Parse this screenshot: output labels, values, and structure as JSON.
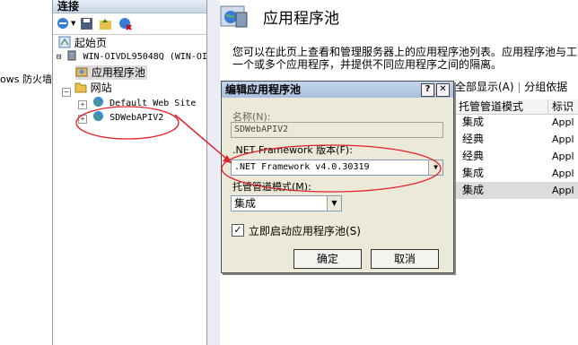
{
  "left_strip": {
    "text": "ows 防火墙"
  },
  "connections": {
    "title": "连接",
    "tree": [
      {
        "label": "起始页",
        "icon": "start-page-icon"
      },
      {
        "label": "WIN-OIVDL95048Q (WIN-OI",
        "icon": "server-icon"
      },
      {
        "label": "应用程序池",
        "icon": "app-pool-icon",
        "selected": true
      },
      {
        "label": "网站",
        "icon": "sites-folder-icon"
      },
      {
        "label": "Default Web Site",
        "icon": "globe-icon"
      },
      {
        "label": "SDWebAPIV2",
        "icon": "globe-icon"
      }
    ]
  },
  "main": {
    "title": "应用程序池",
    "description_line1": "您可以在此页上查看和管理服务器上的应用程序池列表。应用程序池与工",
    "description_line2": "一个或多个应用程序，并提供不同应用程序之间的隔离。",
    "show_all": "全部显示(A)",
    "group_by": "分组依据",
    "columns": [
      "托管管道模式",
      "标识"
    ],
    "rows": [
      {
        "mode": "集成",
        "identity": "Appl"
      },
      {
        "mode": "经典",
        "identity": "Appl"
      },
      {
        "mode": "经典",
        "identity": "Appl"
      },
      {
        "mode": "集成",
        "identity": "Appl"
      },
      {
        "mode": "集成",
        "identity": "Appl",
        "selected": true
      }
    ]
  },
  "dialog": {
    "title": "编辑应用程序池",
    "help_btn": "?",
    "close_btn": "✕",
    "name_label": "名称(N):",
    "name_value": "SDWebAPIV2",
    "framework_label": ".NET Framework 版本(F):",
    "framework_value": ".NET Framework v4.0.30319",
    "pipeline_label": "托管管道模式(M):",
    "pipeline_value": "集成",
    "autostart_label": "立即启动应用程序池(S)",
    "autostart_checked": true,
    "ok": "确定",
    "cancel": "取消"
  },
  "colors": {
    "annotation": "#e0202a",
    "selected_row": "#dcdcdc",
    "dialog_bg": "#ece9d8"
  }
}
